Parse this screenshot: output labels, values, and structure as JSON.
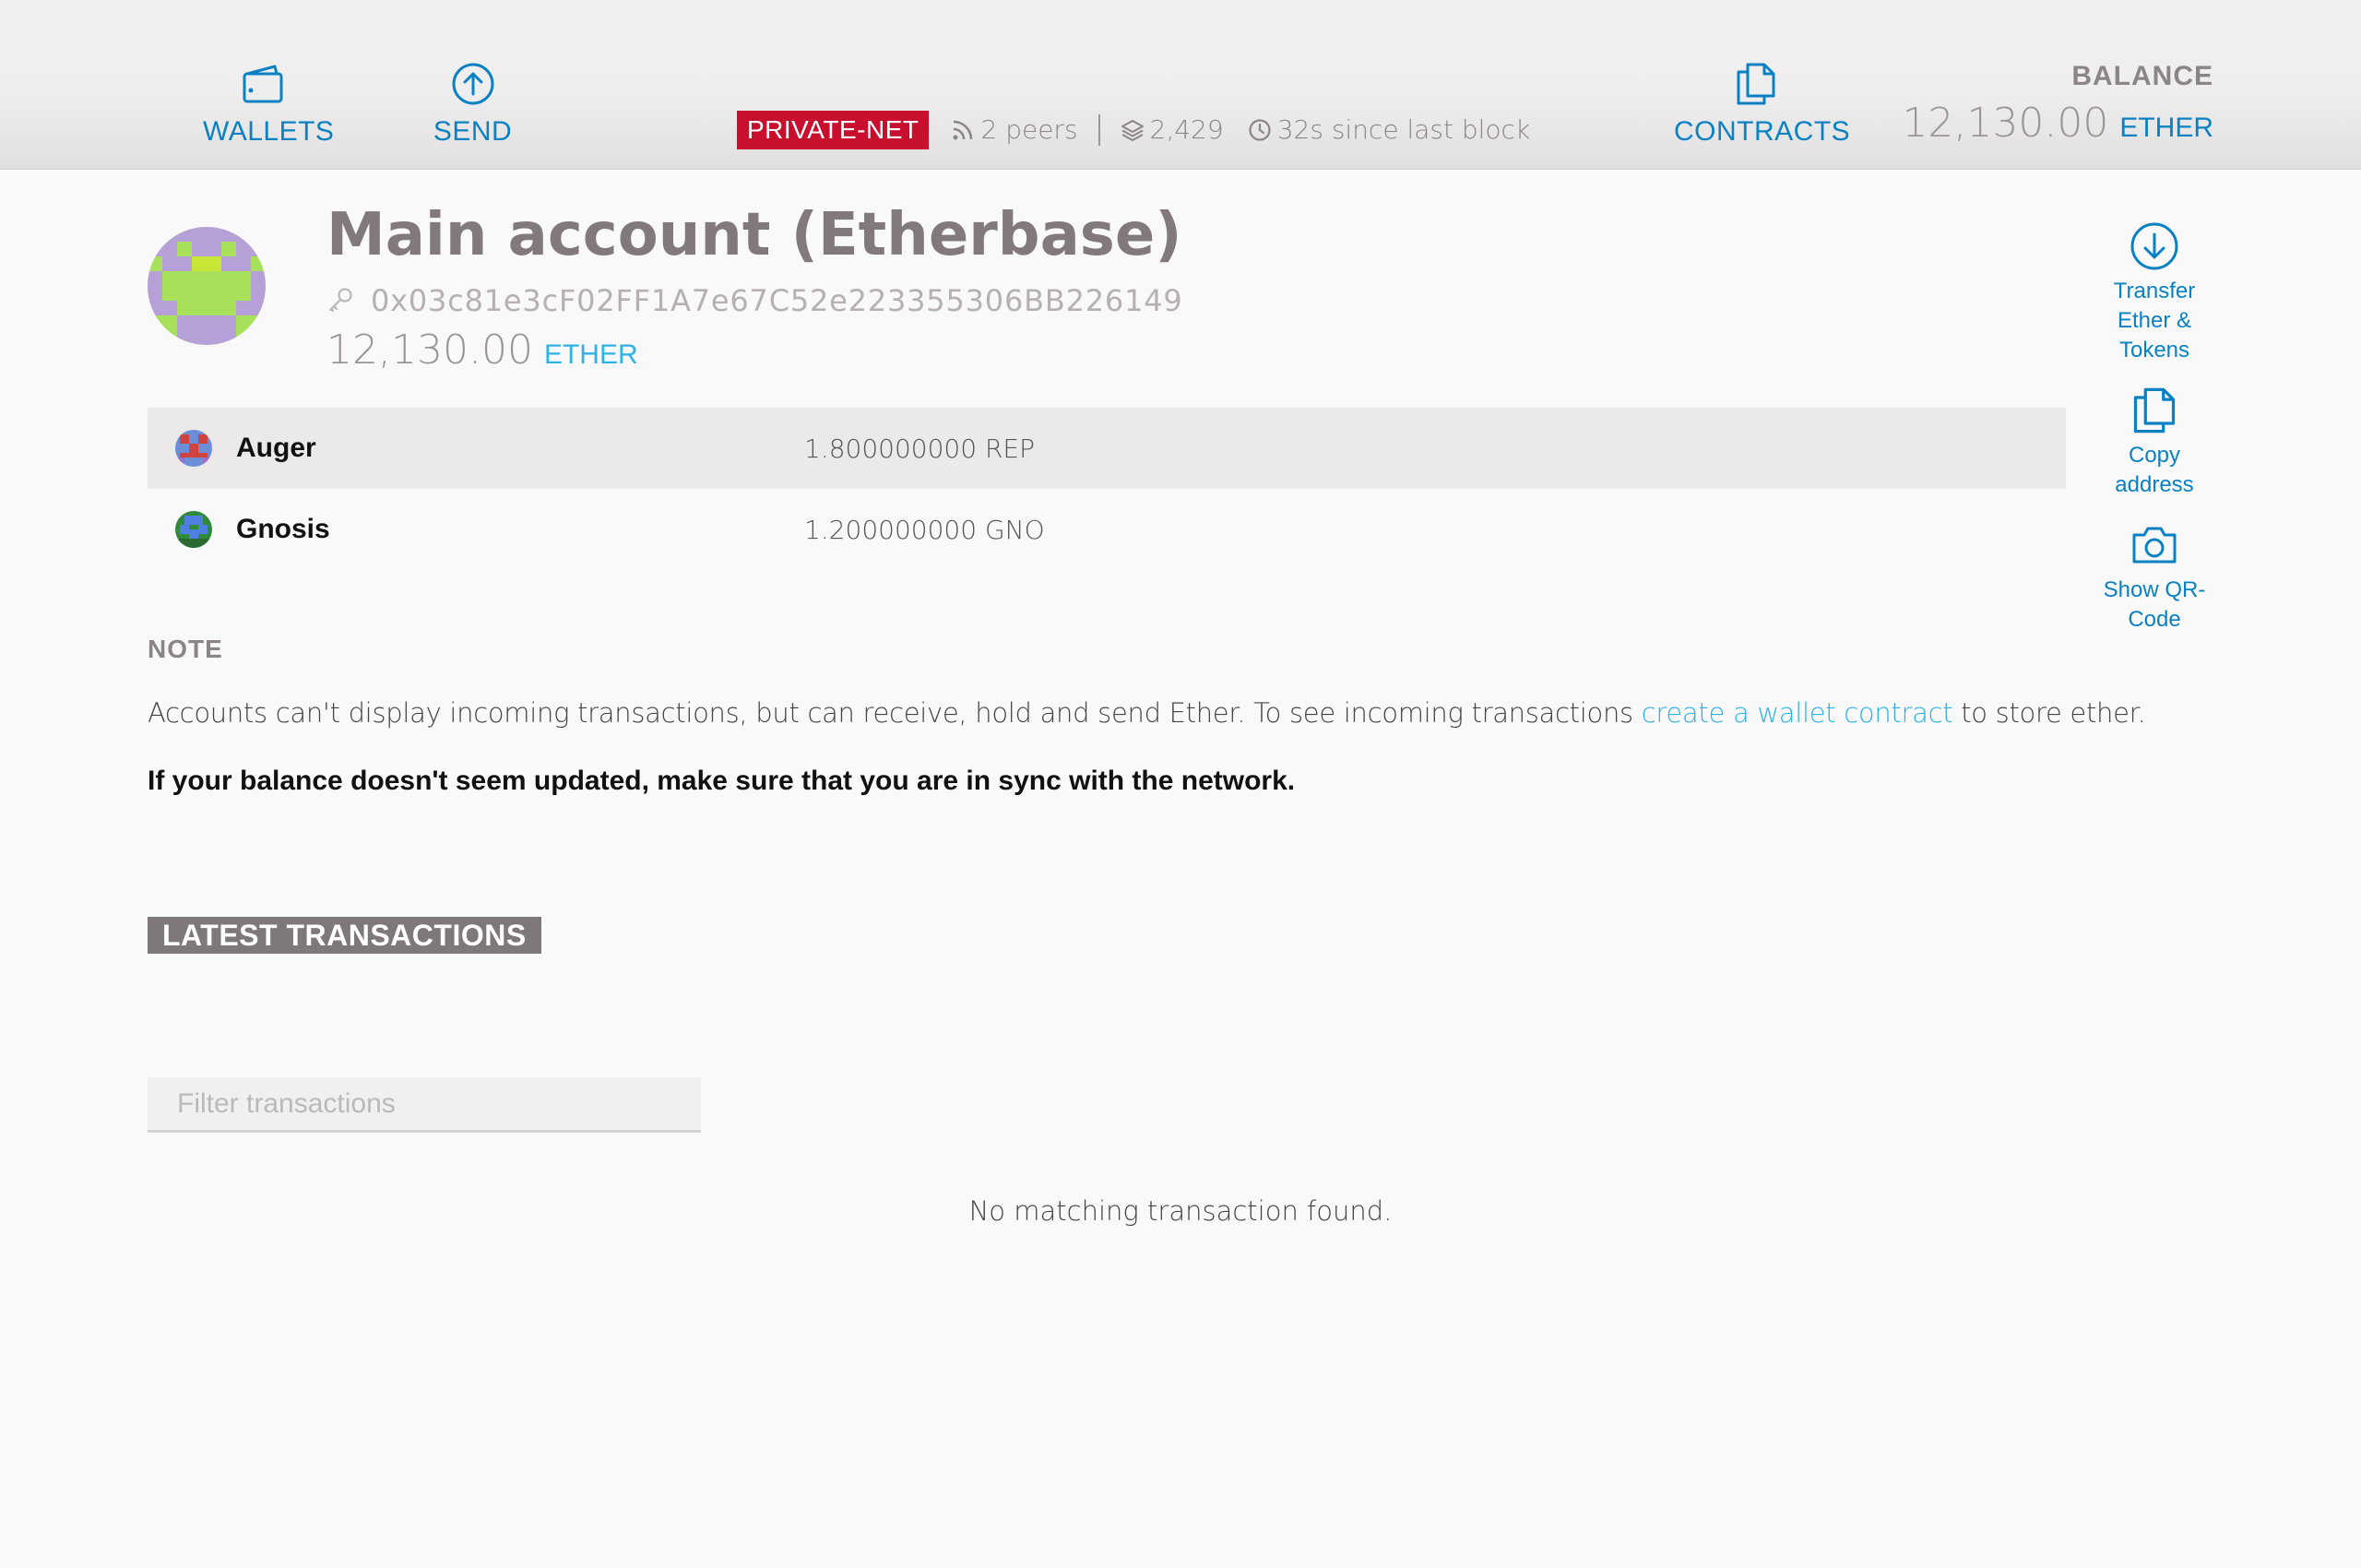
{
  "header": {
    "nav": {
      "wallets": "WALLETS",
      "send": "SEND",
      "contracts": "CONTRACTS"
    },
    "network_badge": "PRIVATE-NET",
    "peers": "2 peers",
    "block_number": "2,429",
    "since_last_block": "32s since last block",
    "balance_title": "BALANCE",
    "balance_amount": "12,130.00",
    "balance_unit": "ETHER"
  },
  "account": {
    "title": "Main account (Etherbase)",
    "address": "0x03c81e3cF02FF1A7e67C52e223355306BB226149",
    "balance_amount": "12,130.00",
    "balance_unit": "ETHER"
  },
  "tokens": [
    {
      "name": "Auger",
      "value": "1.800000000 REP"
    },
    {
      "name": "Gnosis",
      "value": "1.200000000 GNO"
    }
  ],
  "side_actions": {
    "transfer": "Transfer Ether & Tokens",
    "copy": "Copy address",
    "qr": "Show QR-Code"
  },
  "note": {
    "title": "NOTE",
    "text_before": "Accounts can't display incoming transactions, but can receive, hold and send Ether. To see incoming transactions ",
    "link": "create a wallet contract",
    "text_after": " to store ether.",
    "bold": "If your balance doesn't seem updated, make sure that you are in sync with the network."
  },
  "transactions": {
    "title": "LATEST TRANSACTIONS",
    "filter_placeholder": "Filter transactions",
    "empty": "No matching transaction found."
  },
  "colors": {
    "accent": "#0a81c2",
    "link": "#2eb2e8",
    "network_badge": "#c8102e",
    "muted": "#8b8585"
  }
}
